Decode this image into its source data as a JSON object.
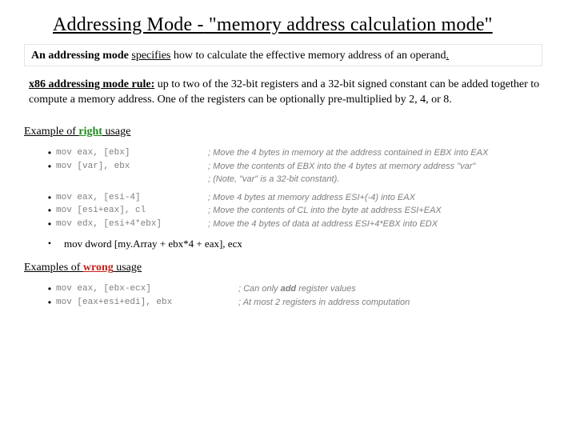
{
  "title": {
    "part1": "Addressing Mode -",
    "part2": " \"memory address calculation mode\""
  },
  "subtitle": {
    "lead": "An addressing mode ",
    "verb": "specifies",
    "rest": " how to calculate the effective memory address of an operand",
    "period": "."
  },
  "rule": {
    "lead": "x86 addressing mode rule:",
    "body": " up to two of the 32-bit registers and a 32-bit signed constant can be added together to compute a memory address. One of the registers can be optionally pre-multiplied by 2, 4, or 8."
  },
  "right_header": {
    "p1": "Example of ",
    "p2": "right",
    "p3": " usage"
  },
  "right_examples": [
    {
      "code": "mov eax, [ebx]",
      "comment": "; Move the 4 bytes in memory at the address contained in EBX into EAX"
    },
    {
      "code": "mov [var], ebx",
      "comment": "; Move the contents of EBX into the 4 bytes at memory address \"var\"\n; (Note, \"var\" is a 32-bit constant)."
    },
    {
      "code": "",
      "comment": ""
    },
    {
      "code": "mov eax, [esi-4]",
      "comment": "; Move 4 bytes at memory address ESI+(-4) into EAX"
    },
    {
      "code": "mov [esi+eax], cl",
      "comment": "; Move the contents of CL into the byte at address ESI+EAX"
    },
    {
      "code": "mov edx, [esi+4*ebx]",
      "comment": "; Move the 4 bytes of data at address ESI+4*EBX into EDX"
    }
  ],
  "extra_line": "mov dword [my.Array + ebx*4 + eax], ecx",
  "wrong_header": {
    "p1": "Examples of ",
    "p2": "wrong",
    "p3": " usage"
  },
  "wrong_examples": [
    {
      "code": "mov eax, [ebx-ecx]",
      "c_pre": "; Can only ",
      "c_bold": "add",
      "c_post": " register values"
    },
    {
      "code": "mov [eax+esi+edi], ebx",
      "c_pre": "; At most 2 registers in address computation",
      "c_bold": "",
      "c_post": ""
    }
  ]
}
